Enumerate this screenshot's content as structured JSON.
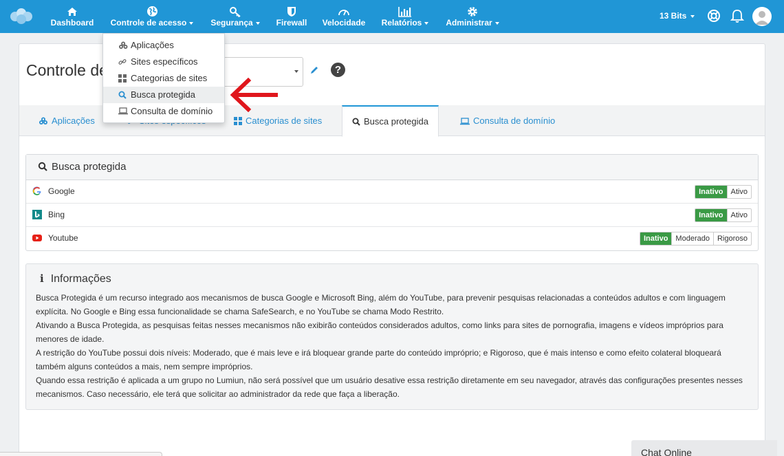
{
  "nav": {
    "items": [
      {
        "label": "Dashboard",
        "icon": "home-icon"
      },
      {
        "label": "Controle de acesso",
        "icon": "globe-icon"
      },
      {
        "label": "Segurança",
        "icon": "key-icon"
      },
      {
        "label": "Firewall",
        "icon": "shield-icon"
      },
      {
        "label": "Velocidade",
        "icon": "speedometer-icon"
      },
      {
        "label": "Relatórios",
        "icon": "bar-chart-icon"
      },
      {
        "label": "Administrar",
        "icon": "gear-icon"
      }
    ],
    "org": "13 Bits"
  },
  "page": {
    "title": "Controle de acesso"
  },
  "tabs": [
    {
      "label": "Aplicações",
      "icon": "applications-icon"
    },
    {
      "label": "Sites específicos",
      "icon": "link-icon"
    },
    {
      "label": "Categorias de sites",
      "icon": "grid-icon"
    },
    {
      "label": "Busca protegida",
      "icon": "search-icon"
    },
    {
      "label": "Consulta de domínio",
      "icon": "laptop-icon"
    }
  ],
  "dropdown": {
    "items": [
      {
        "label": "Aplicações",
        "icon": "applications-icon"
      },
      {
        "label": "Sites específicos",
        "icon": "link-icon"
      },
      {
        "label": "Categorias de sites",
        "icon": "grid-icon"
      },
      {
        "label": "Busca protegida",
        "icon": "search-icon"
      },
      {
        "label": "Consulta de domínio",
        "icon": "laptop-icon"
      }
    ]
  },
  "panel": {
    "title": "Busca protegida",
    "rows": [
      {
        "name": "Google",
        "icon": "google-icon",
        "options": [
          "Inativo",
          "Ativo"
        ],
        "selected": "Inativo"
      },
      {
        "name": "Bing",
        "icon": "bing-icon",
        "options": [
          "Inativo",
          "Ativo"
        ],
        "selected": "Inativo"
      },
      {
        "name": "Youtube",
        "icon": "youtube-icon",
        "options": [
          "Inativo",
          "Moderado",
          "Rigoroso"
        ],
        "selected": "Inativo"
      }
    ]
  },
  "info": {
    "title": "Informações",
    "paragraphs": [
      "Busca Protegida é um recurso integrado aos mecanismos de busca Google e Microsoft Bing, além do YouTube, para prevenir pesquisas relacionadas a conteúdos adultos e com linguagem explícita. No Google e Bing essa funcionalidade se chama SafeSearch, e no YouTube se chama Modo Restrito.",
      "Ativando a Busca Protegida, as pesquisas feitas nesses mecanismos não exibirão conteúdos considerados adultos, como links para sites de pornografia, imagens e vídeos impróprios para menores de idade.",
      "A restrição do YouTube possui dois níveis: Moderado, que é mais leve e irá bloquear grande parte do conteúdo impróprio; e Rigoroso, que é mais intenso e como efeito colateral bloqueará também alguns conteúdos a mais, nem sempre impróprios.",
      "Quando essa restrição é aplicada a um grupo no Lumiun, não será possível que um usuário desative essa restrição diretamente em seu navegador, através das configurações presentes nesses mecanismos. Caso necessário, ele terá que solicitar ao administrador da rede que faça a liberação."
    ]
  },
  "chat": {
    "label": "Chat Online"
  },
  "colors": {
    "brand": "#2096d6",
    "active_toggle": "#3a9a45",
    "annotation_arrow": "#e0161c",
    "link": "#2a8fd0"
  }
}
